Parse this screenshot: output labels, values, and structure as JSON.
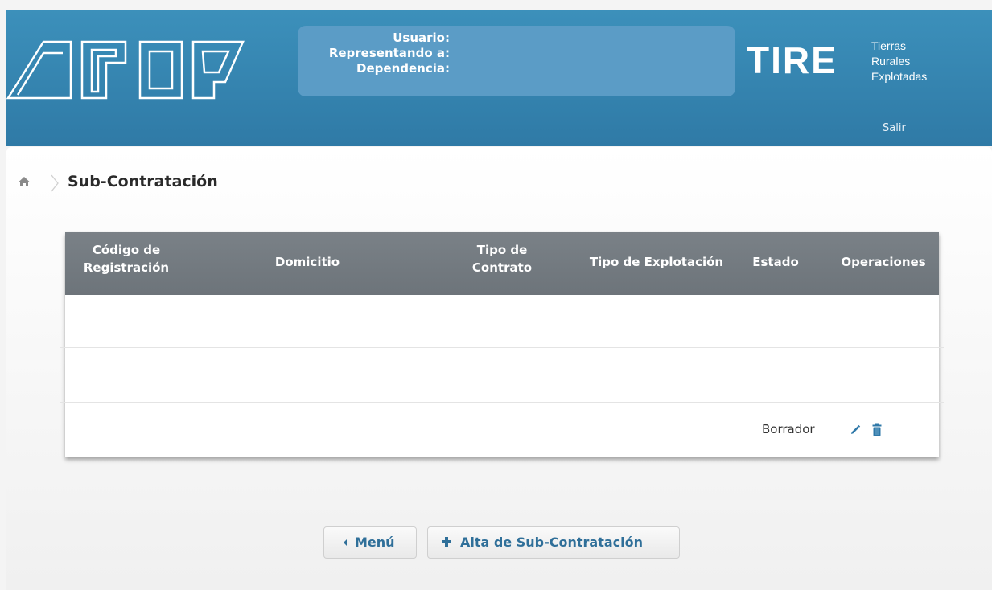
{
  "header": {
    "logo_text": "AFIP",
    "user_labels": [
      "Usuario:",
      "Representando a:",
      "Dependencia:"
    ],
    "app_name": "TIRE",
    "app_subtitle": [
      "Tierras",
      "Rurales",
      "Explotadas"
    ],
    "logout_label": "Salir"
  },
  "breadcrumb": {
    "home_icon": "home-icon",
    "title": "Sub-Contratación"
  },
  "table": {
    "columns": [
      {
        "line1": "Código de",
        "line2": "Registración"
      },
      {
        "line1": "Domicitio",
        "line2": ""
      },
      {
        "line1": "Tipo de",
        "line2": "Contrato"
      },
      {
        "line1": "Tipo de Explotación",
        "line2": ""
      },
      {
        "line1": "Estado",
        "line2": ""
      },
      {
        "line1": "Operaciones",
        "line2": ""
      }
    ],
    "rows": [
      {
        "codigo": "",
        "domicilio": "",
        "tipo_contrato": "",
        "tipo_explotacion": "",
        "estado": "Borrador",
        "operations": [
          "pencil-icon",
          "trash-icon"
        ]
      }
    ]
  },
  "buttons": {
    "menu_label": "Menú",
    "alta_label": "Alta de Sub-Contratación"
  },
  "colors": {
    "header_blue": "#3484b0",
    "table_header": "#737a80",
    "accent": "#2f6f99"
  }
}
